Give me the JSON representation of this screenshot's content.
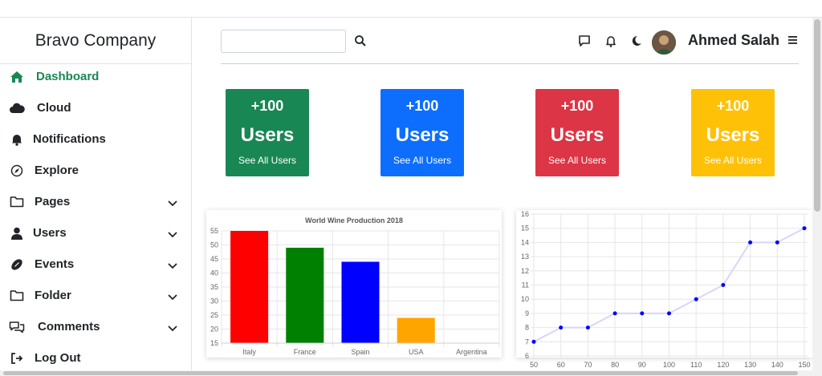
{
  "brand": "Bravo Company",
  "sidebar": {
    "items": [
      {
        "label": "Dashboard",
        "icon": "home-icon",
        "active": true,
        "chevron": false
      },
      {
        "label": "Cloud",
        "icon": "cloud-icon",
        "active": false,
        "chevron": false
      },
      {
        "label": "Notifications",
        "icon": "bell-icon",
        "active": false,
        "chevron": false
      },
      {
        "label": "Explore",
        "icon": "compass-icon",
        "active": false,
        "chevron": false
      },
      {
        "label": "Pages",
        "icon": "folder-icon",
        "active": false,
        "chevron": true
      },
      {
        "label": "Users",
        "icon": "user-icon",
        "active": false,
        "chevron": true
      },
      {
        "label": "Events",
        "icon": "football-icon",
        "active": false,
        "chevron": true
      },
      {
        "label": "Folder",
        "icon": "folder-icon",
        "active": false,
        "chevron": true
      },
      {
        "label": "Comments",
        "icon": "comments-icon",
        "active": false,
        "chevron": true
      },
      {
        "label": "Log Out",
        "icon": "logout-icon",
        "active": false,
        "chevron": false
      }
    ]
  },
  "header": {
    "search_value": "",
    "user_name": "Ahmed Salah"
  },
  "cards": [
    {
      "number": "+100",
      "title": "Users",
      "link": "See All Users",
      "color": "#198754"
    },
    {
      "number": "+100",
      "title": "Users",
      "link": "See All Users",
      "color": "#0d6efd"
    },
    {
      "number": "+100",
      "title": "Users",
      "link": "See All Users",
      "color": "#dc3545"
    },
    {
      "number": "+100",
      "title": "Users",
      "link": "See All Users",
      "color": "#ffc107"
    }
  ],
  "chart_data": [
    {
      "type": "bar",
      "title": "World Wine Production 2018",
      "categories": [
        "Italy",
        "France",
        "Spain",
        "USA",
        "Argentina"
      ],
      "values": [
        55,
        49,
        44,
        24,
        15
      ],
      "colors": [
        "#ff0000",
        "#008000",
        "#0000ff",
        "#ffa500",
        "#a52a2a"
      ],
      "ylim": [
        15,
        55
      ],
      "yticks": [
        15,
        20,
        25,
        30,
        35,
        40,
        45,
        50,
        55
      ],
      "grid": true
    },
    {
      "type": "line",
      "x": [
        50,
        60,
        70,
        80,
        90,
        100,
        110,
        120,
        130,
        140,
        150
      ],
      "y": [
        7,
        8,
        8,
        9,
        9,
        9,
        10,
        11,
        14,
        14,
        15
      ],
      "ylim": [
        6,
        16
      ],
      "yticks": [
        6,
        7,
        8,
        9,
        10,
        11,
        12,
        13,
        14,
        15,
        16
      ],
      "line_color": "#d6d6fb",
      "point_color": "#0000ff",
      "grid": true
    }
  ]
}
